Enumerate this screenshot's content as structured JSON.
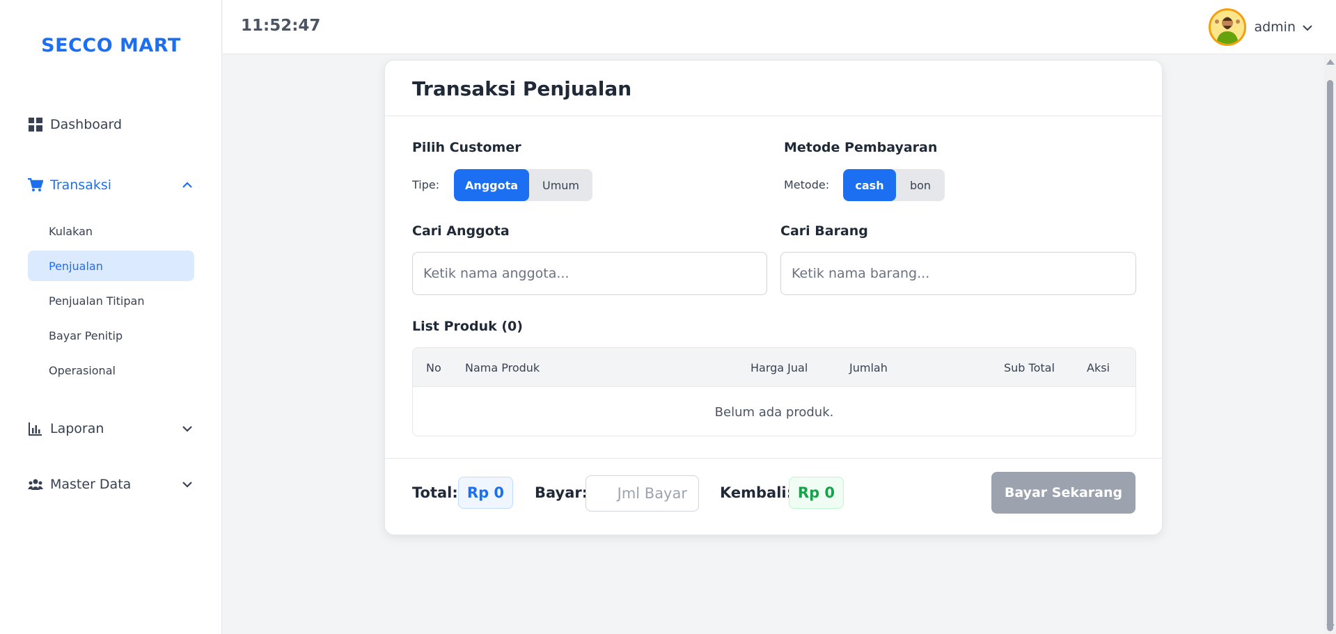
{
  "app": {
    "brand": "SECCO MART"
  },
  "header": {
    "clock": "11:52:47",
    "user_name": "admin"
  },
  "sidebar": {
    "items": [
      {
        "label": "Dashboard"
      },
      {
        "label": "Transaksi"
      },
      {
        "label": "Laporan"
      },
      {
        "label": "Master Data"
      }
    ],
    "transaksi_sub": [
      {
        "label": "Kulakan"
      },
      {
        "label": "Penjualan"
      },
      {
        "label": "Penjualan Titipan"
      },
      {
        "label": "Bayar Penitip"
      },
      {
        "label": "Operasional"
      }
    ]
  },
  "card": {
    "title": "Transaksi Penjualan",
    "customer": {
      "heading": "Pilih Customer",
      "type_label": "Tipe:",
      "options": [
        "Anggota",
        "Umum"
      ],
      "selected": "Anggota"
    },
    "payment": {
      "heading": "Metode Pembayaran",
      "method_label": "Metode:",
      "options": [
        "cash",
        "bon"
      ],
      "selected": "cash"
    },
    "search_member": {
      "heading": "Cari Anggota",
      "placeholder": "Ketik nama anggota..."
    },
    "search_item": {
      "heading": "Cari Barang",
      "placeholder": "Ketik nama barang..."
    },
    "product_list": {
      "heading": "List Produk (0)",
      "columns": [
        "No",
        "Nama Produk",
        "Harga Jual",
        "Jumlah",
        "Sub Total",
        "Aksi"
      ],
      "empty_text": "Belum ada produk."
    },
    "footer": {
      "total_label": "Total:",
      "total_value": "Rp 0",
      "bayar_label": "Bayar:",
      "bayar_placeholder": "Jml Bayar",
      "kembali_label": "Kembali:",
      "kembali_value": "Rp 0",
      "pay_button": "Bayar Sekarang"
    }
  },
  "colors": {
    "accent": "#1d6ff2",
    "success": "#16a34a",
    "disabled": "#9ca3af"
  }
}
